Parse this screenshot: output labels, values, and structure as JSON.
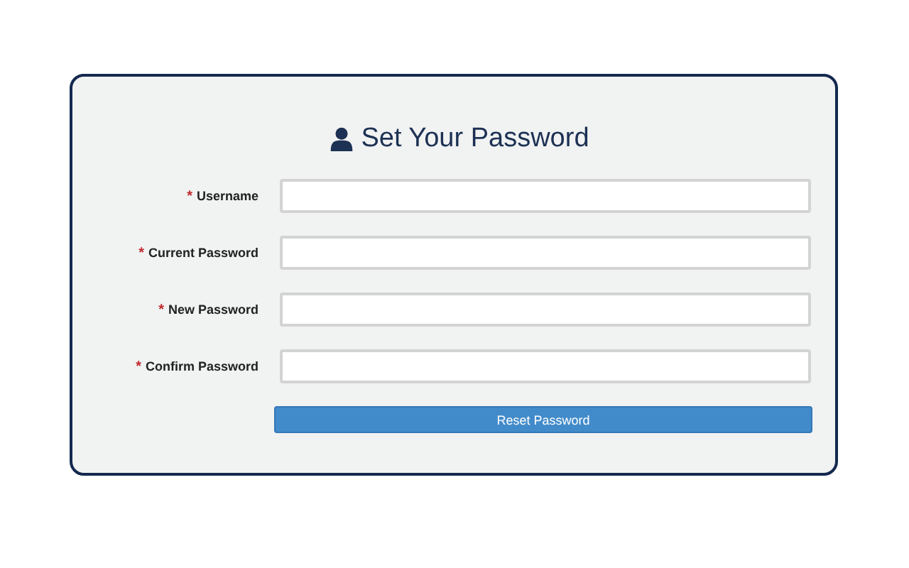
{
  "form": {
    "title": "Set Your Password",
    "fields": [
      {
        "marker": "*",
        "label": "Username"
      },
      {
        "marker": "*",
        "label": "Current Password"
      },
      {
        "marker": "*",
        "label": "New Password"
      },
      {
        "marker": "*",
        "label": "Confirm Password"
      }
    ],
    "submit": "Reset Password"
  }
}
